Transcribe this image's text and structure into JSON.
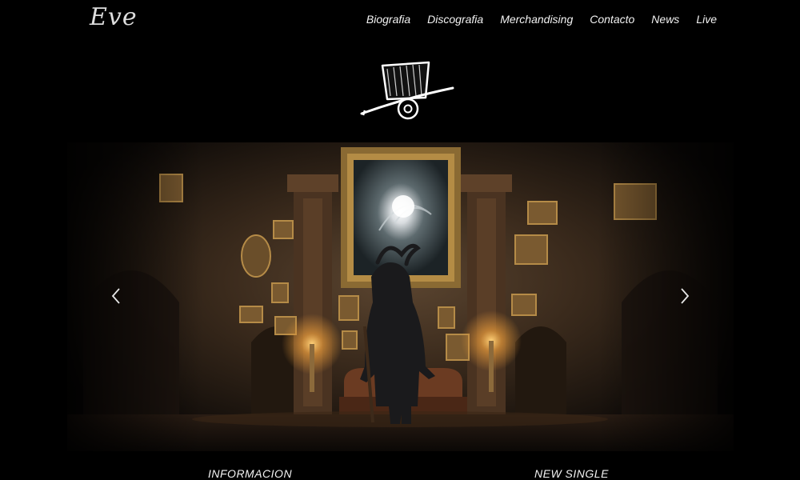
{
  "brand": {
    "logo_text": "Eve"
  },
  "nav": {
    "items": [
      {
        "label": "Biografia"
      },
      {
        "label": "Discografia"
      },
      {
        "label": "Merchandising"
      },
      {
        "label": "Contacto"
      },
      {
        "label": "News"
      },
      {
        "label": "Live"
      }
    ]
  },
  "emblem": {
    "icon": "top-hat-icon"
  },
  "slider": {
    "prev_icon": "chevron-left-icon",
    "next_icon": "chevron-right-icon"
  },
  "sections": {
    "left_title": "INFORMACION",
    "right_title": "NEW SINGLE"
  },
  "colors": {
    "background": "#000000",
    "text": "#f2f2f2",
    "warm_glow": "#e79a3a"
  }
}
